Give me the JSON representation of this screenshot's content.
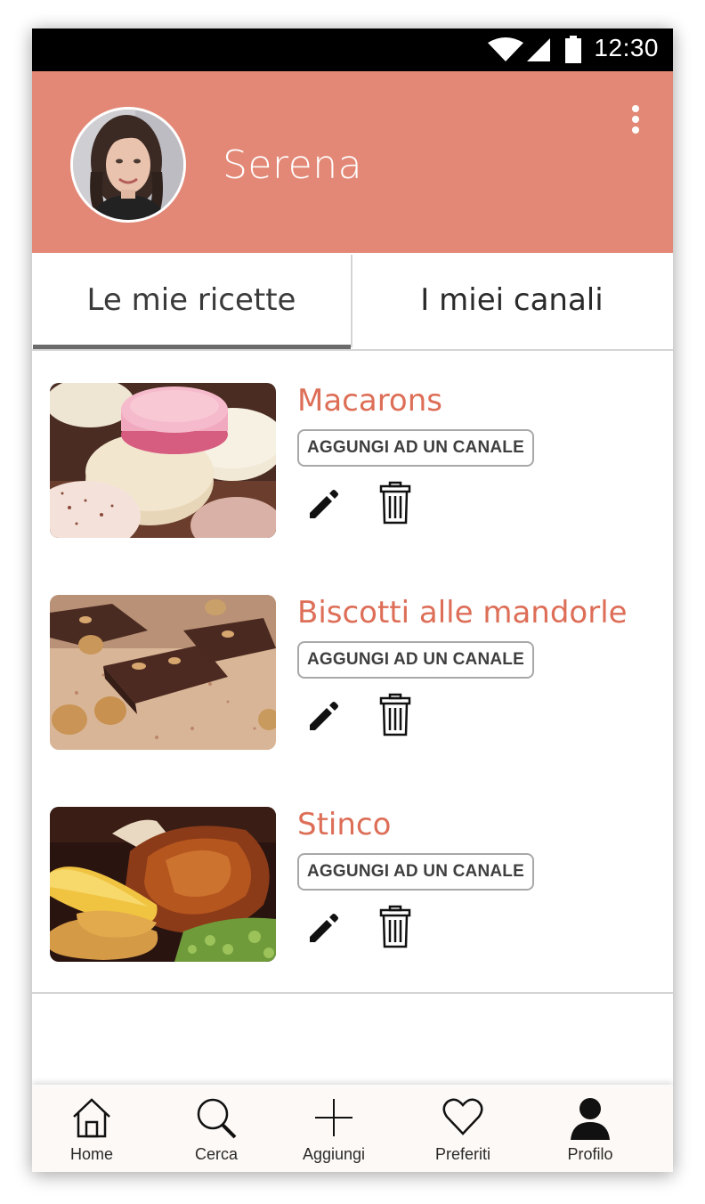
{
  "status_bar": {
    "time": "12:30"
  },
  "profile": {
    "name": "Serena"
  },
  "tabs": [
    {
      "label": "Le mie ricette",
      "active": true
    },
    {
      "label": "I miei canali",
      "active": false
    }
  ],
  "recipes": [
    {
      "title": "Macarons",
      "action_label": "AGGUNGI AD UN CANALE"
    },
    {
      "title": "Biscotti alle mandorle",
      "action_label": "AGGUNGI AD UN CANALE"
    },
    {
      "title": "Stinco",
      "action_label": "AGGUNGI AD UN CANALE"
    }
  ],
  "bottom_nav": [
    {
      "label": "Home",
      "icon": "home-icon"
    },
    {
      "label": "Cerca",
      "icon": "search-icon"
    },
    {
      "label": "Aggiungi",
      "icon": "plus-icon"
    },
    {
      "label": "Preferiti",
      "icon": "heart-icon"
    },
    {
      "label": "Profilo",
      "icon": "person-icon",
      "active": true
    }
  ],
  "colors": {
    "header": "#E38876",
    "accent_text": "#DD6E57",
    "nav_background": "#FDF9F6"
  }
}
